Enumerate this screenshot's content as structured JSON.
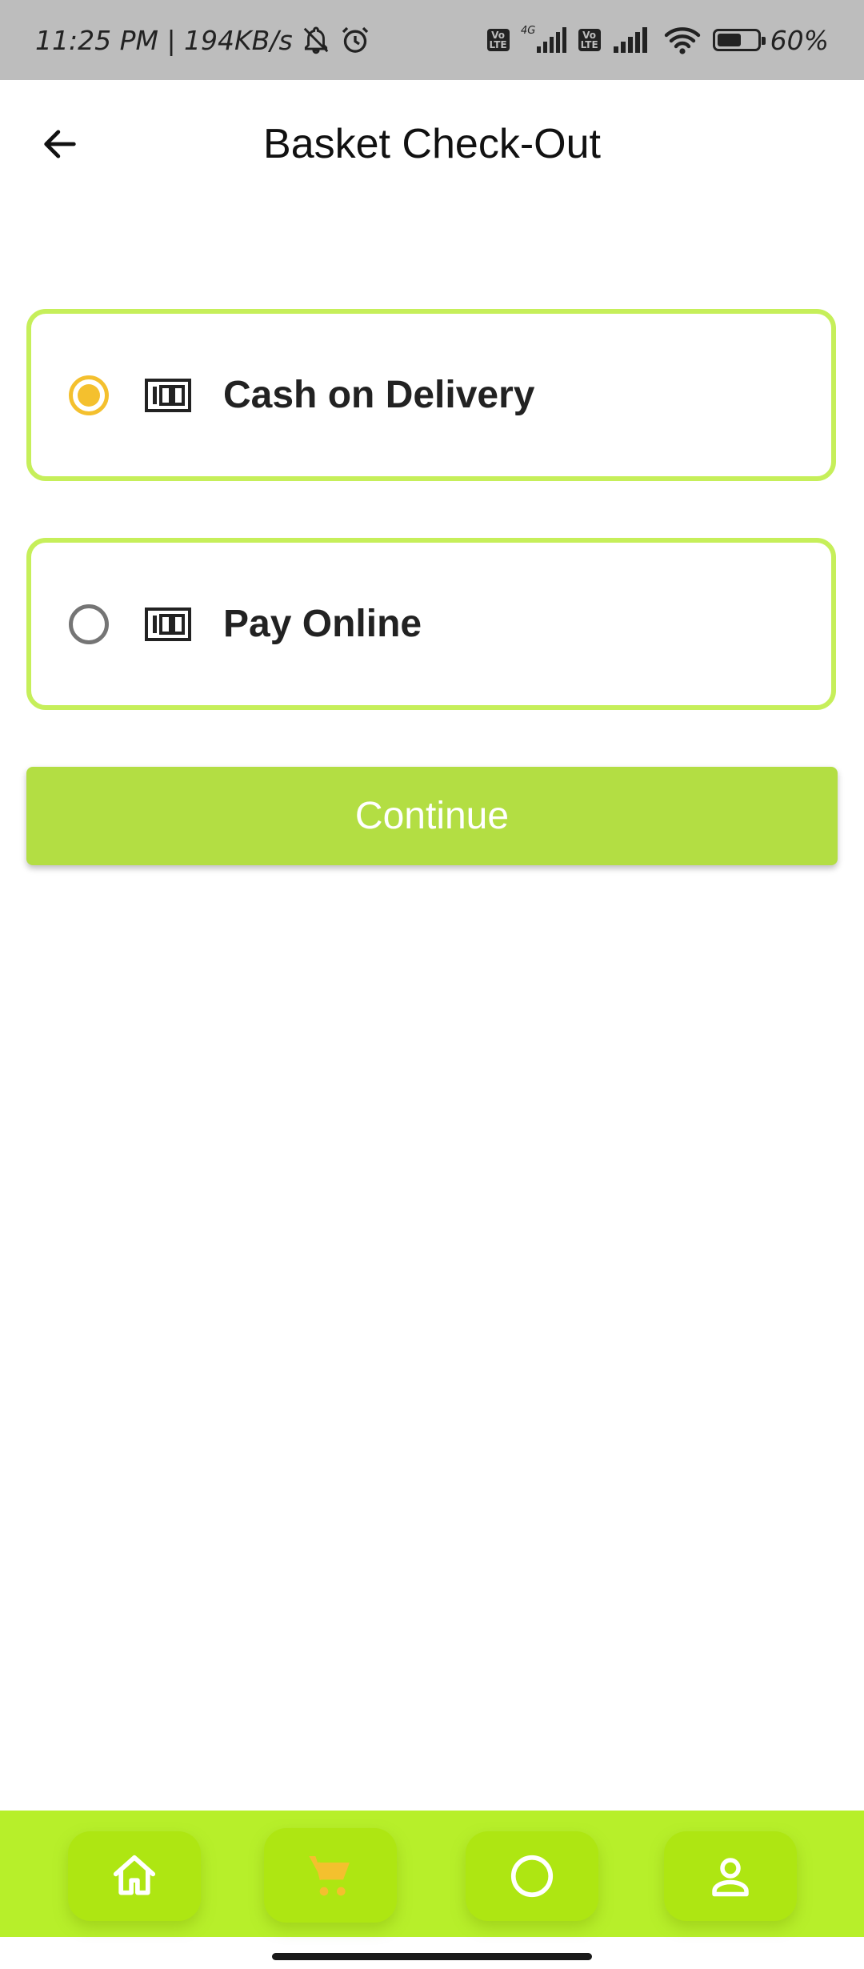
{
  "status_bar": {
    "time_speed": "11:25 PM | 194KB/s",
    "network_type": "4G",
    "volte_label": "Vo\nLTE",
    "battery_percent": "60%",
    "battery_level": 0.6,
    "icons": [
      "bell-off-icon",
      "alarm-icon",
      "volte-icon",
      "signal-icon",
      "volte-icon",
      "signal-icon",
      "wifi-icon",
      "battery-icon"
    ]
  },
  "header": {
    "title": "Basket Check-Out",
    "back_icon": "arrow-left-icon"
  },
  "payment_options": [
    {
      "label": "Cash on Delivery",
      "selected": true,
      "icon": "money-icon"
    },
    {
      "label": "Pay Online",
      "selected": false,
      "icon": "money-icon"
    }
  ],
  "continue_label": "Continue",
  "bottom_nav": {
    "items": [
      {
        "icon": "home-icon",
        "active": false
      },
      {
        "icon": "cart-icon",
        "active": true
      },
      {
        "icon": "circle-icon",
        "active": false
      },
      {
        "icon": "person-icon",
        "active": false
      }
    ]
  },
  "colors": {
    "accent_border": "#c6ef5a",
    "button": "#b3de43",
    "radio_selected": "#f4c02e",
    "nav_bg": "#b7ef2a",
    "cart_active": "#f4c02e"
  }
}
